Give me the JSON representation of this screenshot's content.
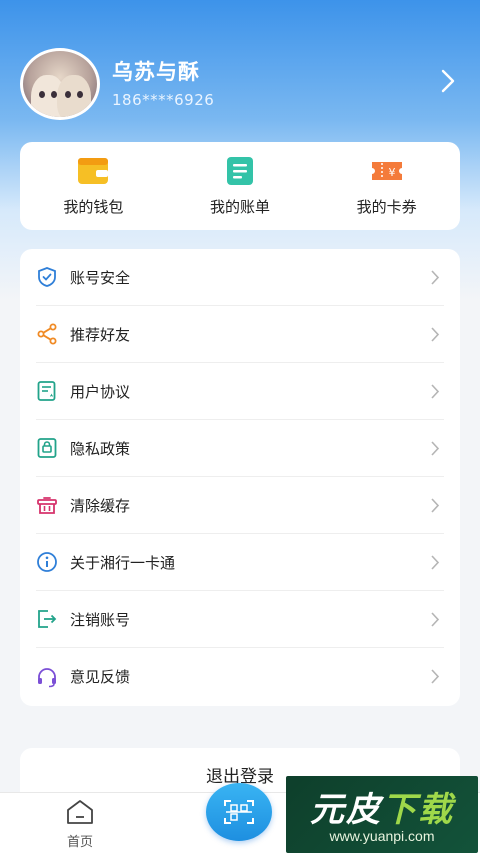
{
  "profile": {
    "name": "乌苏与酥",
    "phone": "186****6926"
  },
  "quick_actions": [
    {
      "label": "我的钱包",
      "icon": "wallet-icon",
      "color": "#f5b81c"
    },
    {
      "label": "我的账单",
      "icon": "bill-icon",
      "color": "#2fc1a6"
    },
    {
      "label": "我的卡券",
      "icon": "coupon-icon",
      "color": "#f27a3a"
    }
  ],
  "menu": [
    {
      "label": "账号安全",
      "icon": "shield-icon"
    },
    {
      "label": "推荐好友",
      "icon": "share-icon"
    },
    {
      "label": "用户协议",
      "icon": "agreement-icon"
    },
    {
      "label": "隐私政策",
      "icon": "privacy-icon"
    },
    {
      "label": "清除缓存",
      "icon": "trash-icon"
    },
    {
      "label": "关于湘行一卡通",
      "icon": "info-icon"
    },
    {
      "label": "注销账号",
      "icon": "logout-icon"
    },
    {
      "label": "意见反馈",
      "icon": "headset-icon"
    }
  ],
  "logout_label": "退出登录",
  "tabbar": {
    "home_label": "首页",
    "scan_icon": "scan-icon"
  },
  "watermark": {
    "text_a": "元皮",
    "text_b": "下载",
    "url": "www.yuanpi.com"
  },
  "colors": {
    "header_gradient_top": "#3d93ea",
    "scan_button": "#1e8fe0",
    "watermark_bg": "#13533a"
  }
}
